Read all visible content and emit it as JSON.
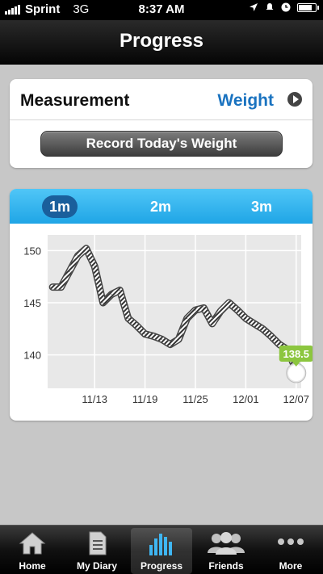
{
  "status_bar": {
    "carrier": "Sprint",
    "network": "3G",
    "time": "8:37 AM",
    "icons": [
      "location-arrow-icon",
      "alarm-icon",
      "clock-icon",
      "battery-icon"
    ],
    "battery_percent": 85
  },
  "nav": {
    "title": "Progress"
  },
  "measurement": {
    "label": "Measurement",
    "value": "Weight",
    "value_color": "#1a73c0",
    "record_button": "Record Today's Weight"
  },
  "range_tabs": [
    {
      "label": "1m",
      "active": true
    },
    {
      "label": "2m",
      "active": false
    },
    {
      "label": "3m",
      "active": false
    }
  ],
  "chart_data": {
    "type": "line",
    "title": "",
    "xlabel": "",
    "ylabel": "",
    "x_ticks": [
      "11/13",
      "11/19",
      "11/25",
      "12/01",
      "12/07"
    ],
    "y_ticks": [
      140,
      145,
      150
    ],
    "ylim": [
      136.8,
      151.5
    ],
    "grid": true,
    "series": [
      {
        "x": [
          "11/08",
          "11/09",
          "11/10",
          "11/11",
          "11/12",
          "11/13",
          "11/14",
          "11/15",
          "11/16",
          "11/17",
          "11/18",
          "11/19",
          "11/20",
          "11/21",
          "11/22",
          "11/23",
          "11/24",
          "11/25",
          "11/26",
          "11/27",
          "11/28",
          "11/29",
          "11/30",
          "12/01",
          "12/02",
          "12/03",
          "12/04",
          "12/05",
          "12/06",
          "12/07"
        ],
        "values": [
          146.5,
          146.5,
          148.0,
          149.5,
          150.2,
          148.5,
          145.0,
          145.8,
          146.2,
          143.5,
          142.8,
          142.0,
          141.8,
          141.5,
          141.0,
          141.5,
          143.5,
          144.3,
          144.5,
          143.0,
          144.2,
          145.0,
          144.3,
          143.5,
          143.0,
          142.5,
          141.8,
          141.0,
          140.5,
          138.5
        ]
      }
    ],
    "latest_label": "138.5",
    "latest_label_color": "#8cc63f",
    "line_color": "#333333"
  },
  "tab_bar": [
    {
      "label": "Home",
      "icon": "home-icon",
      "active": false
    },
    {
      "label": "My Diary",
      "icon": "diary-icon",
      "active": false
    },
    {
      "label": "Progress",
      "icon": "progress-bars-icon",
      "active": true
    },
    {
      "label": "Friends",
      "icon": "friends-icon",
      "active": false
    },
    {
      "label": "More",
      "icon": "more-dots-icon",
      "active": false
    }
  ]
}
